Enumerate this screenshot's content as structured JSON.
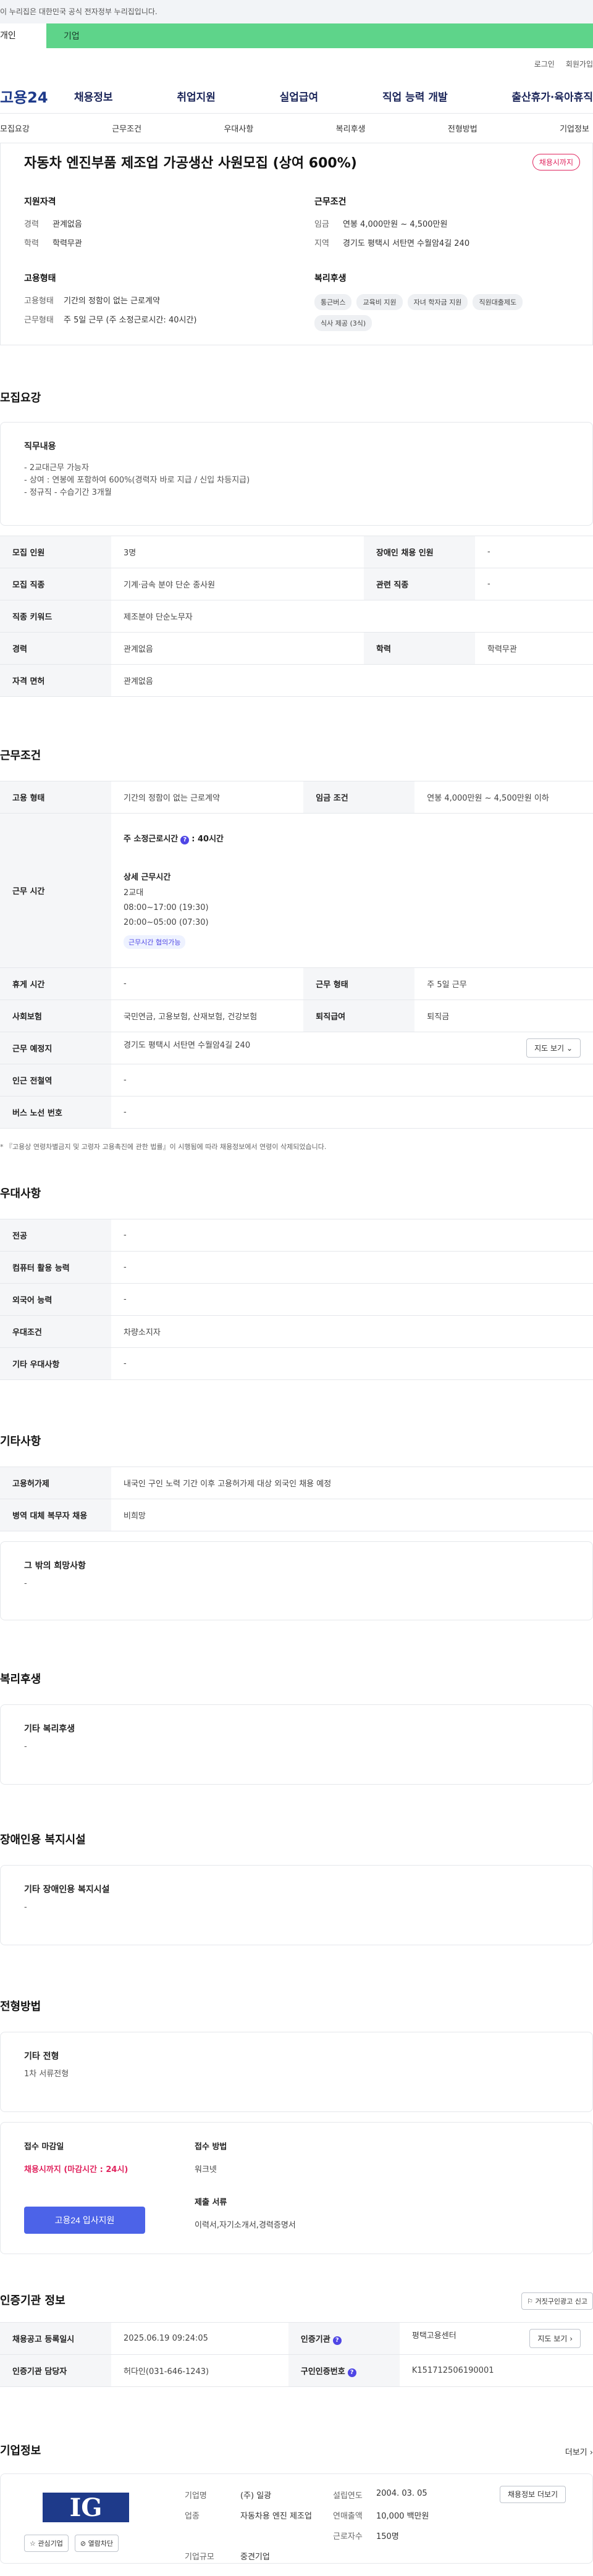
{
  "gov_banner": "이 누리집은 대한민국 공식 전자정부 누리집입니다.",
  "green_bar": {
    "tab1": "개인",
    "tab2": "기업"
  },
  "util": {
    "login": "로그인",
    "signup": "회원가입"
  },
  "gnb": {
    "logo": "고용24",
    "menu": [
      "채용정보",
      "취업지원",
      "실업급여",
      "직업 능력 개발",
      "출산휴가·육아휴직"
    ]
  },
  "subnav": [
    "모집요강",
    "근무조건",
    "우대사항",
    "복리후생",
    "전형방법",
    "기업정보"
  ],
  "summary": {
    "title": "자동차 엔진부품 제조업 가공생산 사원모집 (상여 600%)",
    "badge": "채용시까지",
    "qual": {
      "heading": "지원자격",
      "career_k": "경력",
      "career_v": "관계없음",
      "edu_k": "학력",
      "edu_v": "학력무관"
    },
    "cond": {
      "heading": "근무조건",
      "wage_k": "임금",
      "wage_v": "연봉 4,000만원 ~ 4,500만원",
      "loc_k": "지역",
      "loc_v": "경기도 평택시 서탄면 수월암4길 240"
    },
    "emp": {
      "heading": "고용형태",
      "type_k": "고용형태",
      "type_v": "기간의 정함이 없는 근로계약",
      "hours_k": "근무형태",
      "hours_v": "주 5일 근무 (주 소정근로시간: 40시간)"
    },
    "welfare": {
      "heading": "복리후생",
      "tags": [
        "통근버스",
        "교육비 지원",
        "자녀 학자금 지원",
        "직원대출제도",
        "식사 제공 (3식)"
      ]
    }
  },
  "recruit": {
    "title": "모집요강",
    "duty_heading": "직무내용",
    "duty_lines": [
      "- 2교대근무 가능자",
      "- 상여 : 연봉에 포함하여 600%(경력자 바로 지급 / 신입 차등지급)",
      "- 정규직 - 수습기간 3개월"
    ],
    "rows": {
      "count_k": "모집 인원",
      "count_v": "3명",
      "disabled_k": "장애인 채용 인원",
      "disabled_v": "-",
      "job_k": "모집 직종",
      "job_v": "기계·금속 분야 단순 종사원",
      "rel_k": "관련 직종",
      "rel_v": "-",
      "kw_k": "직종 키워드",
      "kw_v": "제조분야 단순노무자",
      "career_k": "경력",
      "career_v": "관계없음",
      "edu_k": "학력",
      "edu_v": "학력무관",
      "license_k": "자격 면허",
      "license_v": "관계없음"
    }
  },
  "work": {
    "title": "근무조건",
    "emp_k": "고용 형태",
    "emp_v": "기간의 정함이 없는 근로계약",
    "wage_k": "임금 조건",
    "wage_v": "연봉 4,000만원 ~ 4,500만원 이하",
    "hours_k": "근무 시간",
    "hours_main": "주 소정근로시간",
    "hours_suffix": ": 40시간",
    "detail_heading": "상세 근무시간",
    "detail_lines": [
      "2교대",
      "08:00~17:00 (19:30)",
      "20:00~05:00 (07:30)"
    ],
    "chip": "근무시간 협의가능",
    "break_k": "휴게 시간",
    "break_v": "-",
    "shape_k": "근무 형태",
    "shape_v": "주 5일 근무",
    "ins_k": "사회보험",
    "ins_v": "국민연금, 고용보험, 산재보험, 건강보험",
    "ret_k": "퇴직급여",
    "ret_v": "퇴직금",
    "place_k": "근무 예정지",
    "place_v": "경기도 평택시 서탄면 수월암4길 240",
    "map_btn": "지도 보기",
    "station_k": "인근 전철역",
    "station_v": "-",
    "bus_k": "버스 노선 번호",
    "bus_v": "-",
    "note": "* 『고용상 연령차별금지 및 고령자 고용촉진에 관한 법률』이 시행됨에 따라 채용정보에서 연령이 삭제되었습니다."
  },
  "pref": {
    "title": "우대사항",
    "major_k": "전공",
    "major_v": "-",
    "pc_k": "컴퓨터 활용 능력",
    "pc_v": "-",
    "lang_k": "외국어 능력",
    "lang_v": "-",
    "cond_k": "우대조건",
    "cond_v": "차량소지자",
    "etc_k": "기타 우대사항",
    "etc_v": "-"
  },
  "etc": {
    "title": "기타사항",
    "permit_k": "고용허가제",
    "permit_v": "내국인 구인 노력 기간 이후 고용허가제 대상 외국인 채용 예정",
    "military_k": "병역 대체 복무자 채용",
    "military_v": "비희망",
    "other_heading": "그 밖의 희망사항",
    "other_v": "-"
  },
  "welfare": {
    "title": "복리후생",
    "heading": "기타 복리후생",
    "value": "-"
  },
  "disabled": {
    "title": "장애인용 복지시설",
    "heading": "기타 장애인용 복지시설",
    "value": "-"
  },
  "selection": {
    "title": "전형방법",
    "heading": "기타 전형",
    "value": "1차 서류전형",
    "deadline_heading": "접수 마감일",
    "deadline_v": "채용시까지 (마감시간 : 24시)",
    "apply_btn": "고용24 입사지원",
    "method_heading": "접수 방법",
    "method_v": "워크넷",
    "docs_heading": "제출 서류",
    "docs_v": "이력서,자기소개서,경력증명서"
  },
  "agency": {
    "title": "인증기관 정보",
    "report_btn": "거짓구인광고 신고",
    "reg_k": "채용공고 등록일시",
    "reg_v": "2025.06.19 09:24:05",
    "org_k": "인증기관",
    "org_v": "평택고용센터",
    "map_btn": "지도 보기",
    "staff_k": "인증기관 담당자",
    "staff_v": "허다인(031-646-1243)",
    "no_k": "구인인증번호",
    "no_v": "K151712506190001"
  },
  "company": {
    "title": "기업정보",
    "more": "더보기",
    "logo_text": "IG",
    "fav_btn": "관심기업",
    "block_btn": "열람차단",
    "name_k": "기업명",
    "name_v": "(주) 일광",
    "est_k": "설립연도",
    "est_v": "2004. 03. 05",
    "jobs_btn": "채용정보 더보기",
    "ind_k": "업종",
    "ind_v": "자동차용 엔진 제조업",
    "sales_k": "연매출액",
    "sales_v": "10,000 백만원",
    "emp_k": "근로자수",
    "emp_v": "150명",
    "size_k": "기업규모",
    "size_v": "중견기업"
  }
}
